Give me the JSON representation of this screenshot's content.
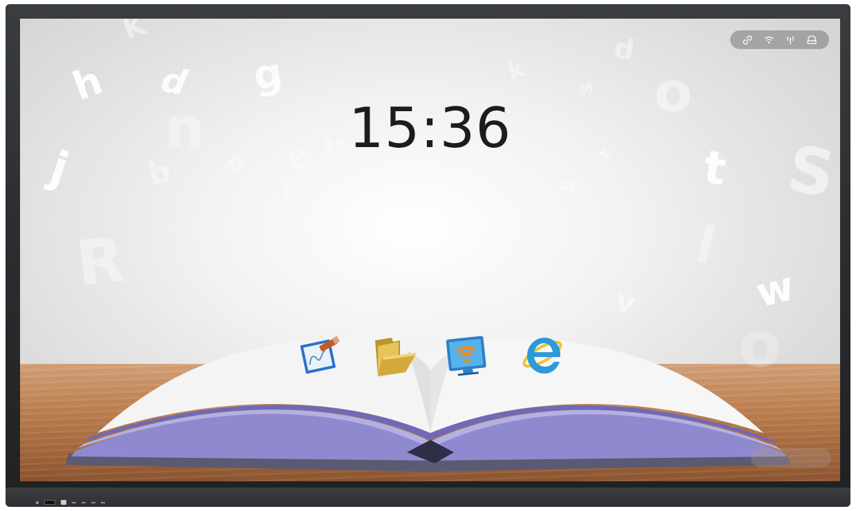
{
  "home": {
    "clock": "15:36"
  },
  "status_bar": {
    "icons": [
      "link-icon",
      "wifi-icon",
      "hotspot-icon",
      "usb-drive-icon"
    ]
  },
  "dock": {
    "apps": [
      {
        "name": "whiteboard",
        "icon": "whiteboard-icon"
      },
      {
        "name": "file-manager",
        "icon": "folder-icon"
      },
      {
        "name": "wireless-screen-share",
        "icon": "screen-share-icon"
      },
      {
        "name": "browser",
        "icon": "internet-explorer-icon"
      }
    ]
  },
  "wallpaper": {
    "letters": [
      "h",
      "d",
      "g",
      "n",
      "j",
      "b",
      "p",
      "e",
      "u",
      "k",
      "r",
      "R",
      "k",
      "s",
      "o",
      "s",
      "r",
      "t",
      "S",
      "w",
      "v",
      "l",
      "o",
      "d",
      "K"
    ],
    "accent_colors": {
      "wood": "#b5774a",
      "pages": "#8f8ad0",
      "clock": "#1c1c1c"
    }
  }
}
